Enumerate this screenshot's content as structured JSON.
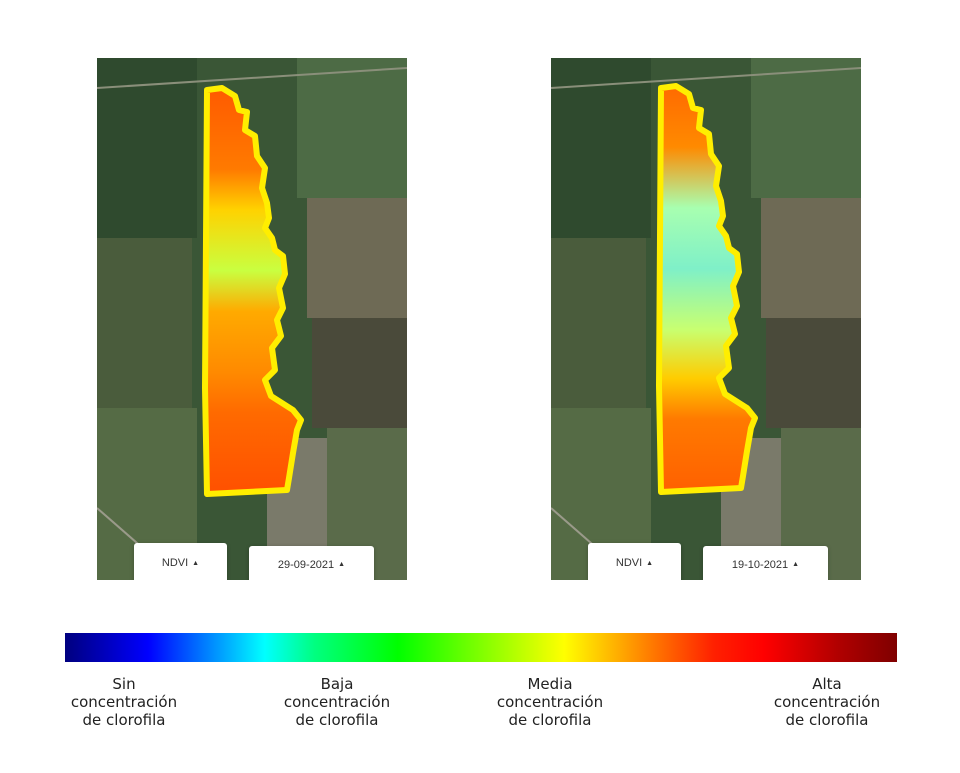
{
  "maps": [
    {
      "index_label": "NDVI",
      "date": "29-09-2021"
    },
    {
      "index_label": "NDVI",
      "date": "19-10-2021"
    }
  ],
  "icons": {
    "dropdown": "caret-up-icon"
  },
  "colors": {
    "field_outline": "#ffee00",
    "scale": [
      "#00007f",
      "#0000ff",
      "#00ffff",
      "#00ff00",
      "#ffff00",
      "#ff8000",
      "#ff0000",
      "#7f0000"
    ]
  },
  "legend": [
    {
      "line1": "Sin",
      "line2": "concentración",
      "line3": "de clorofila"
    },
    {
      "line1": "Baja",
      "line2": "concentración",
      "line3": "de clorofila"
    },
    {
      "line1": "Media",
      "line2": "concentración",
      "line3": "de clorofila"
    },
    {
      "line1": "Alta",
      "line2": "concentración",
      "line3": "de clorofila"
    }
  ]
}
